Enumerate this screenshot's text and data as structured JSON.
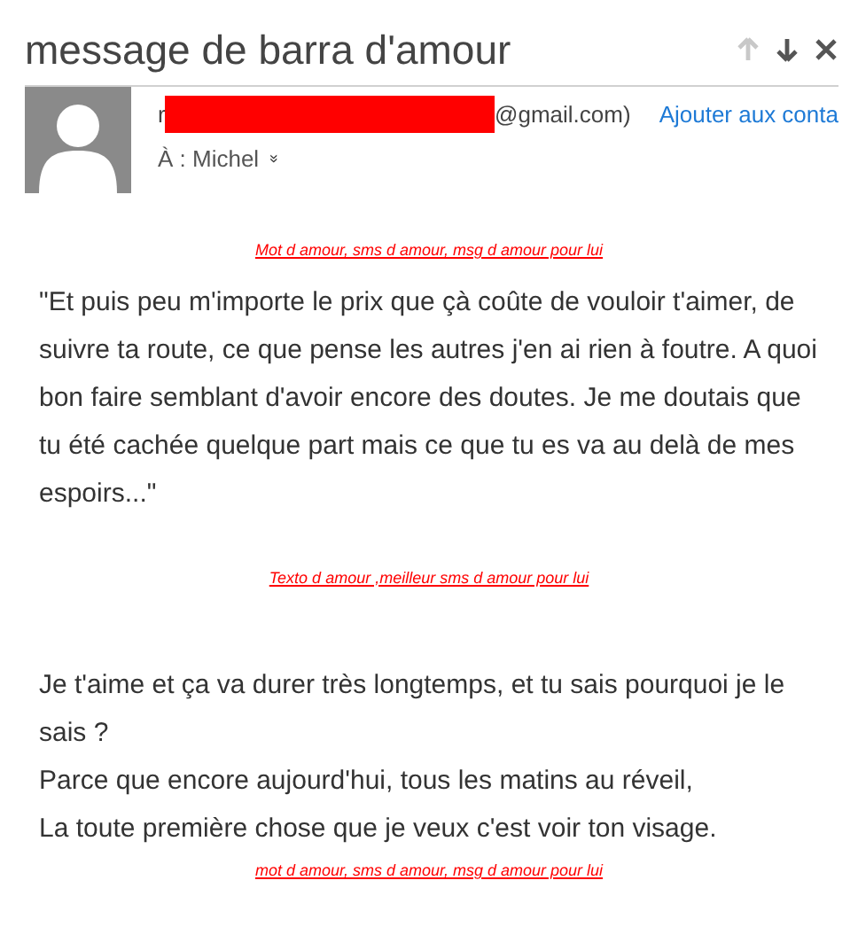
{
  "window": {
    "title": "message de barra d'amour"
  },
  "nav": [
    {
      "kind": "up",
      "disabled": true
    },
    {
      "kind": "down",
      "disabled": false
    },
    {
      "kind": "close",
      "disabled": false
    }
  ],
  "sender": {
    "prefix": "r",
    "redacted": true,
    "suffix": "@gmail.com)",
    "add_link": "Ajouter aux conta"
  },
  "recipient": {
    "label": "À : Michel",
    "expand": "»"
  },
  "body": [
    {
      "kind": "link",
      "text": "Mot d amour, sms d amour, msg d amour pour lui"
    },
    {
      "kind": "paragraph",
      "lines": [
        "\"Et puis peu m'importe le prix que çà coûte de vouloir t'aimer, de suivre ta route, ce que pense les autres j'en ai rien à foutre. A quoi bon faire semblant d'avoir encore des doutes. Je me doutais que tu été cachée quelque part mais ce que tu es va au delà de mes espoirs...\""
      ]
    },
    {
      "kind": "link",
      "text": "Texto d amour ,meilleur sms d amour pour lui"
    },
    {
      "kind": "paragraph",
      "lines": [
        "Je t'aime et ça va durer très longtemps, et tu sais pourquoi je le sais ?",
        "Parce que encore aujourd'hui, tous les matins au réveil,",
        "La toute première chose que je veux c'est voir ton visage."
      ]
    },
    {
      "kind": "link",
      "text": "mot d amour, sms d amour, msg d amour pour lui"
    }
  ]
}
